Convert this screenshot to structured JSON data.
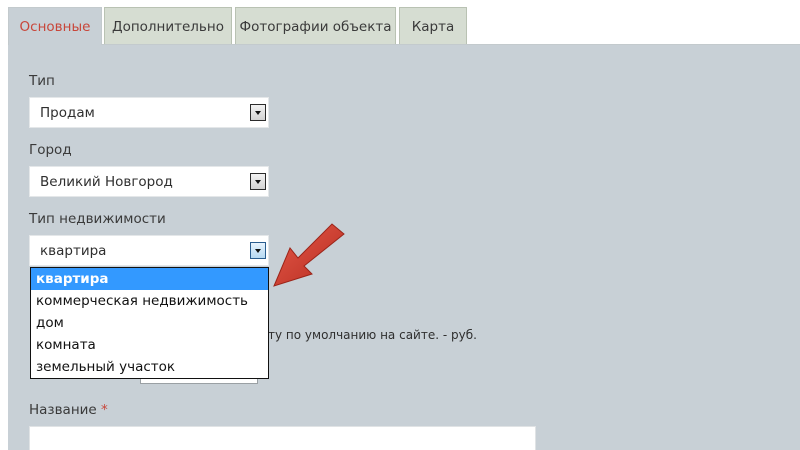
{
  "tabs": [
    {
      "label": "Основные"
    },
    {
      "label": "Дополнительно"
    },
    {
      "label": "Фотографии объекта"
    },
    {
      "label": "Карта"
    }
  ],
  "form": {
    "type_label": "Тип",
    "type_value": "Продам",
    "city_label": "Город",
    "city_value": "Великий Новгород",
    "property_type_label": "Тип недвижимости",
    "property_type_value": "квартира",
    "property_type_options": [
      "квартира",
      "коммерческая недвижимость",
      "дом",
      "комната",
      "земельный участок"
    ],
    "price_hint": "ту по умолчанию на сайте. - руб.",
    "name_label": "Название",
    "name_required_mark": "*",
    "name_value": ""
  },
  "colors": {
    "accent": "#c8463a",
    "selected_option": "#3399ff",
    "panel": "#c8d0d6",
    "annotation_arrow": "#d33a2c"
  }
}
